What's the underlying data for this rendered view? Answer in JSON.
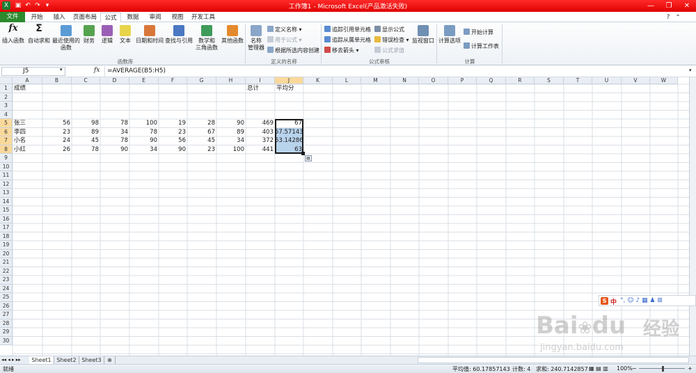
{
  "window": {
    "title": "工作簿1 - Microsoft Excel(产品激活失败)"
  },
  "tabs": [
    "文件",
    "开始",
    "插入",
    "页面布局",
    "公式",
    "数据",
    "审阅",
    "视图",
    "开发工具"
  ],
  "active_tab": "公式",
  "ribbon": {
    "groups": {
      "function_library": "函数库",
      "defined_names": "定义的名称",
      "formula_auditing": "公式审核",
      "calculation": "计算"
    },
    "insert_function": "插入函数",
    "autosum": "自动求和",
    "recent": "最近使用的",
    "recent2": "函数",
    "financial": "财务",
    "logical": "逻辑",
    "text": "文本",
    "datetime": "日期和时间",
    "lookup": "查找与引用",
    "math": "数学和",
    "math2": "三角函数",
    "more": "其他函数",
    "name_manager": "名称",
    "name_manager2": "管理器",
    "define_name": "定义名称",
    "use_in_formula": "用于公式",
    "create_from_selection": "根据所选内容创建",
    "trace_precedents": "追踪引用单元格",
    "trace_dependents": "追踪从属单元格",
    "remove_arrows": "移去箭头",
    "show_formulas": "显示公式",
    "error_checking": "错误检查",
    "evaluate_formula": "公式求值",
    "watch_window": "监视窗口",
    "calc_options": "计算选项",
    "calc_now": "开始计算",
    "calc_sheet": "计算工作表"
  },
  "formula_bar": {
    "name_box": "J5",
    "fx": "fx",
    "formula": "=AVERAGE(B5:H5)"
  },
  "columns": [
    "A",
    "B",
    "C",
    "D",
    "E",
    "F",
    "G",
    "H",
    "I",
    "J",
    "K",
    "L",
    "M",
    "N",
    "O",
    "P",
    "Q",
    "R",
    "S",
    "T",
    "U",
    "V",
    "W"
  ],
  "cells": {
    "A1": "成绩",
    "I1": "总计",
    "J1": "平均分",
    "A5": "张三",
    "B5": "56",
    "C5": "98",
    "D5": "78",
    "E5": "100",
    "F5": "19",
    "G5": "28",
    "H5": "90",
    "I5": "469",
    "J5": "67",
    "A6": "李四",
    "B6": "23",
    "C6": "89",
    "D6": "34",
    "E6": "78",
    "F6": "23",
    "G6": "67",
    "H6": "89",
    "I6": "403",
    "J6": "57.57143",
    "A7": "小名",
    "B7": "24",
    "C7": "45",
    "D7": "78",
    "E7": "90",
    "F7": "56",
    "G7": "45",
    "H7": "34",
    "I7": "372",
    "J7": "53.14286",
    "A8": "小红",
    "B8": "26",
    "C8": "78",
    "D8": "90",
    "E8": "34",
    "F8": "90",
    "G8": "23",
    "H8": "100",
    "I8": "441",
    "J8": "63"
  },
  "sheets": [
    "Sheet1",
    "Sheet2",
    "Sheet3"
  ],
  "status": {
    "ready": "就绪",
    "average": "平均值: 60.17857143",
    "count": "计数: 4",
    "sum": "求和: 240.7142857",
    "zoom": "100%"
  },
  "ime": {
    "lang": "中"
  },
  "watermark": {
    "brand": "Bai",
    "brand2": "du",
    "cn": "经验",
    "url": "jingyan.baidu.com"
  },
  "colors": {
    "title_bar": "#e00000",
    "file_tab": "#2d8a2d",
    "selection": "#b8d3ec",
    "header_selected": "#f9d99b"
  }
}
